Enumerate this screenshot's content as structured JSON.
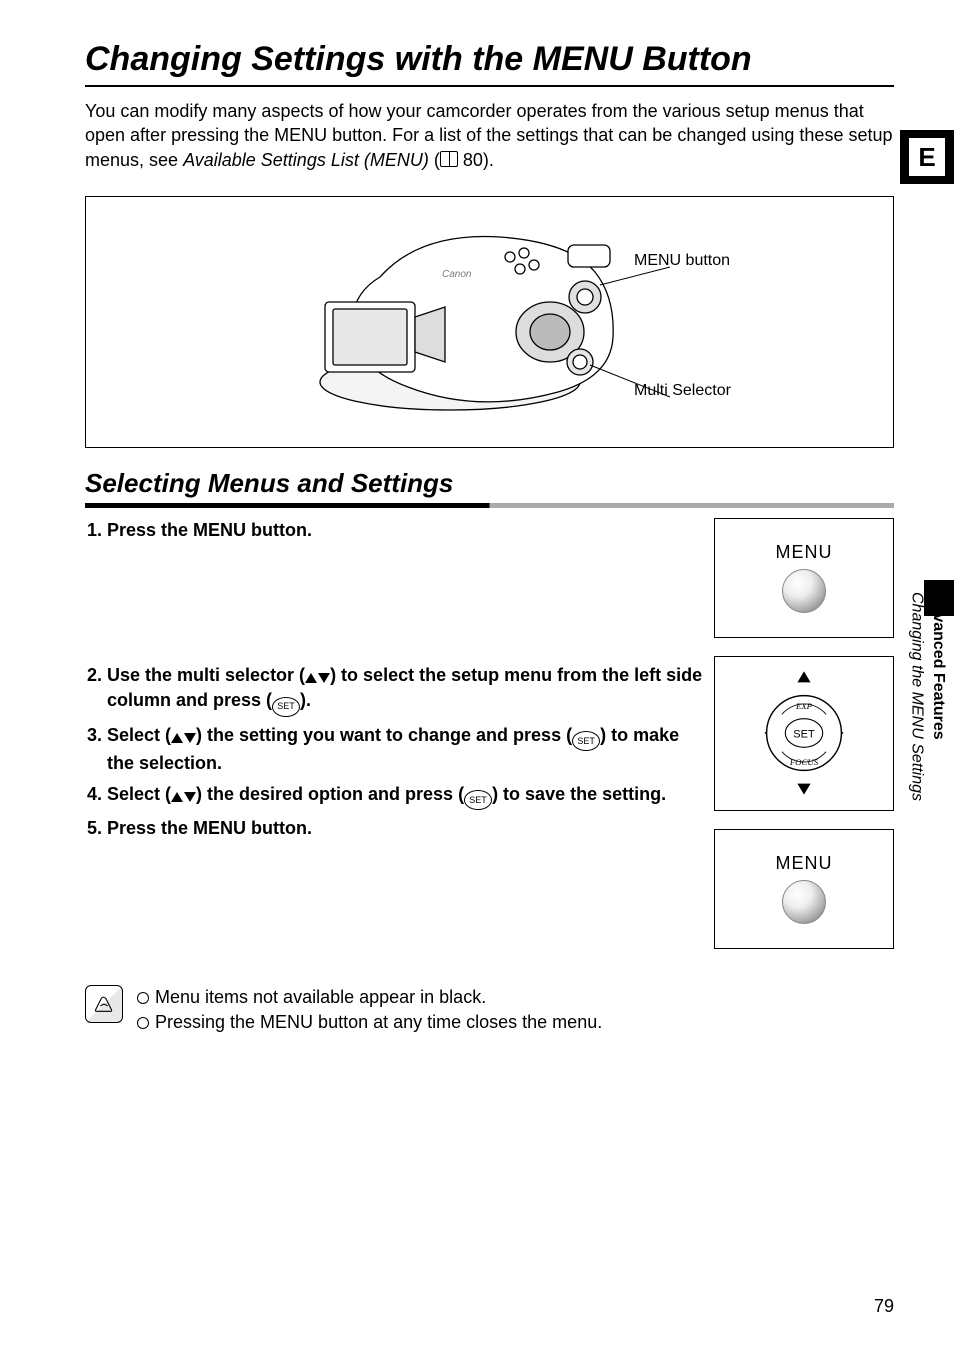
{
  "title": "Changing Settings with the MENU Button",
  "intro": {
    "line1": "You can modify many aspects of how your camcorder operates from the various setup menus that open after pressing the MENU button. For a list of the settings that can be changed using these setup menus, see ",
    "italic": "Available Settings List (MENU)",
    "after_italic_open": " (",
    "page_ref": " 80).",
    "close": ""
  },
  "lang_tab": "E",
  "diagram": {
    "label_menu": "MENU button",
    "label_selector": "Multi Selector"
  },
  "subheading": "Selecting Menus and Settings",
  "steps": {
    "s1": "Press the MENU button.",
    "s2a": "Use the multi selector (",
    "s2b": ") to select the setup menu from the left side column and press (",
    "s2c": ").",
    "s3a": "Select (",
    "s3b": ") the setting you want to change and press (",
    "s3c": ") to make the selection.",
    "s4a": "Select (",
    "s4b": ") the desired option and press (",
    "s4c": ") to save the setting.",
    "s5": "Press the MENU button."
  },
  "fig_menu_label": "MENU",
  "selector_fig": {
    "top": "EXP",
    "mid": "SET",
    "bot": "FOCUS"
  },
  "notes": {
    "n1": "Menu items not available appear in black.",
    "n2": "Pressing the MENU button at any time closes the menu."
  },
  "side": {
    "bold": "Advanced Features",
    "ital": "Changing the MENU Settings"
  },
  "page_number": "79"
}
